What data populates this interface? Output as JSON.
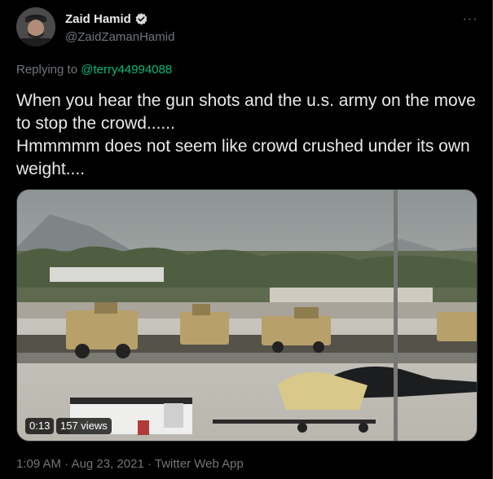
{
  "author": {
    "display_name": "Zaid Hamid",
    "handle": "@ZaidZamanHamid",
    "verified": true
  },
  "more_label": "···",
  "reply": {
    "prefix": "Replying to ",
    "mention": "@terry44994088"
  },
  "tweet_text": "When you hear the gun shots and the u.s. army on the move to stop the crowd......\nHmmmmm does not seem like crowd crushed under its own weight....",
  "video": {
    "duration": "0:13",
    "views": "157 views"
  },
  "meta": {
    "time": "1:09 AM",
    "separator": "·",
    "date": "Aug 23, 2021",
    "source": "Twitter Web App"
  },
  "colors": {
    "background": "#000000",
    "text": "#e7e9ea",
    "secondary": "#71767b",
    "mention": "#00ba7c",
    "verified": "#d9d9d9"
  }
}
